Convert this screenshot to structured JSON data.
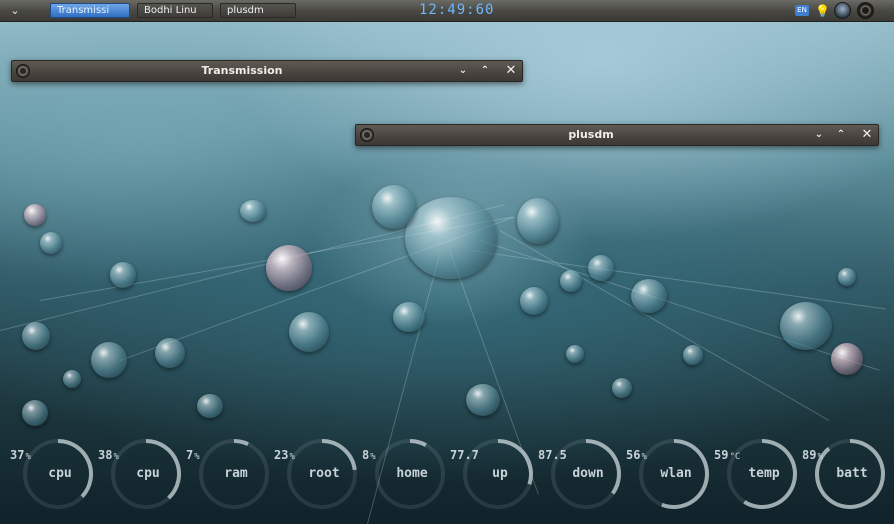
{
  "panel": {
    "menu_icon": "chevron-down-icon",
    "tasks": [
      {
        "label": "Transmissi",
        "active": true
      },
      {
        "label": "Bodhi Linu",
        "active": false
      },
      {
        "label": "plusdm",
        "active": false
      }
    ],
    "clock": "12:49:60",
    "tray": {
      "keyboard_label": "EN",
      "icons": [
        "keyboard-icon",
        "lightbulb-icon",
        "monitor-icon",
        "power-icon"
      ]
    }
  },
  "windows": [
    {
      "title": "Transmission",
      "controls": [
        "minimize",
        "maximize",
        "close"
      ]
    },
    {
      "title": "plusdm",
      "controls": [
        "minimize",
        "maximize",
        "close"
      ]
    }
  ],
  "window_controls": {
    "minimize": "⌄",
    "maximize": "⌃",
    "close": "✕"
  },
  "gauges": [
    {
      "value": "37",
      "unit": "%",
      "label": "cpu",
      "fraction": 0.37
    },
    {
      "value": "38",
      "unit": "%",
      "label": "cpu",
      "fraction": 0.38
    },
    {
      "value": "7",
      "unit": "%",
      "label": "ram",
      "fraction": 0.07
    },
    {
      "value": "23",
      "unit": "%",
      "label": "root",
      "fraction": 0.23
    },
    {
      "value": "8",
      "unit": "%",
      "label": "home",
      "fraction": 0.08
    },
    {
      "value": "77.7",
      "unit": "",
      "label": "up",
      "fraction": 0.3
    },
    {
      "value": "87.5",
      "unit": "",
      "label": "down",
      "fraction": 0.35
    },
    {
      "value": "56",
      "unit": "%",
      "label": "wlan",
      "fraction": 0.56
    },
    {
      "value": "59",
      "unit": "°C",
      "label": "temp",
      "fraction": 0.59
    },
    {
      "value": "89",
      "unit": "%",
      "label": "batt",
      "fraction": 0.89
    }
  ],
  "colors": {
    "clock": "#6fb6ff",
    "active_task": "#2f6fc4",
    "gauge_ring": "#c7d3d6"
  }
}
